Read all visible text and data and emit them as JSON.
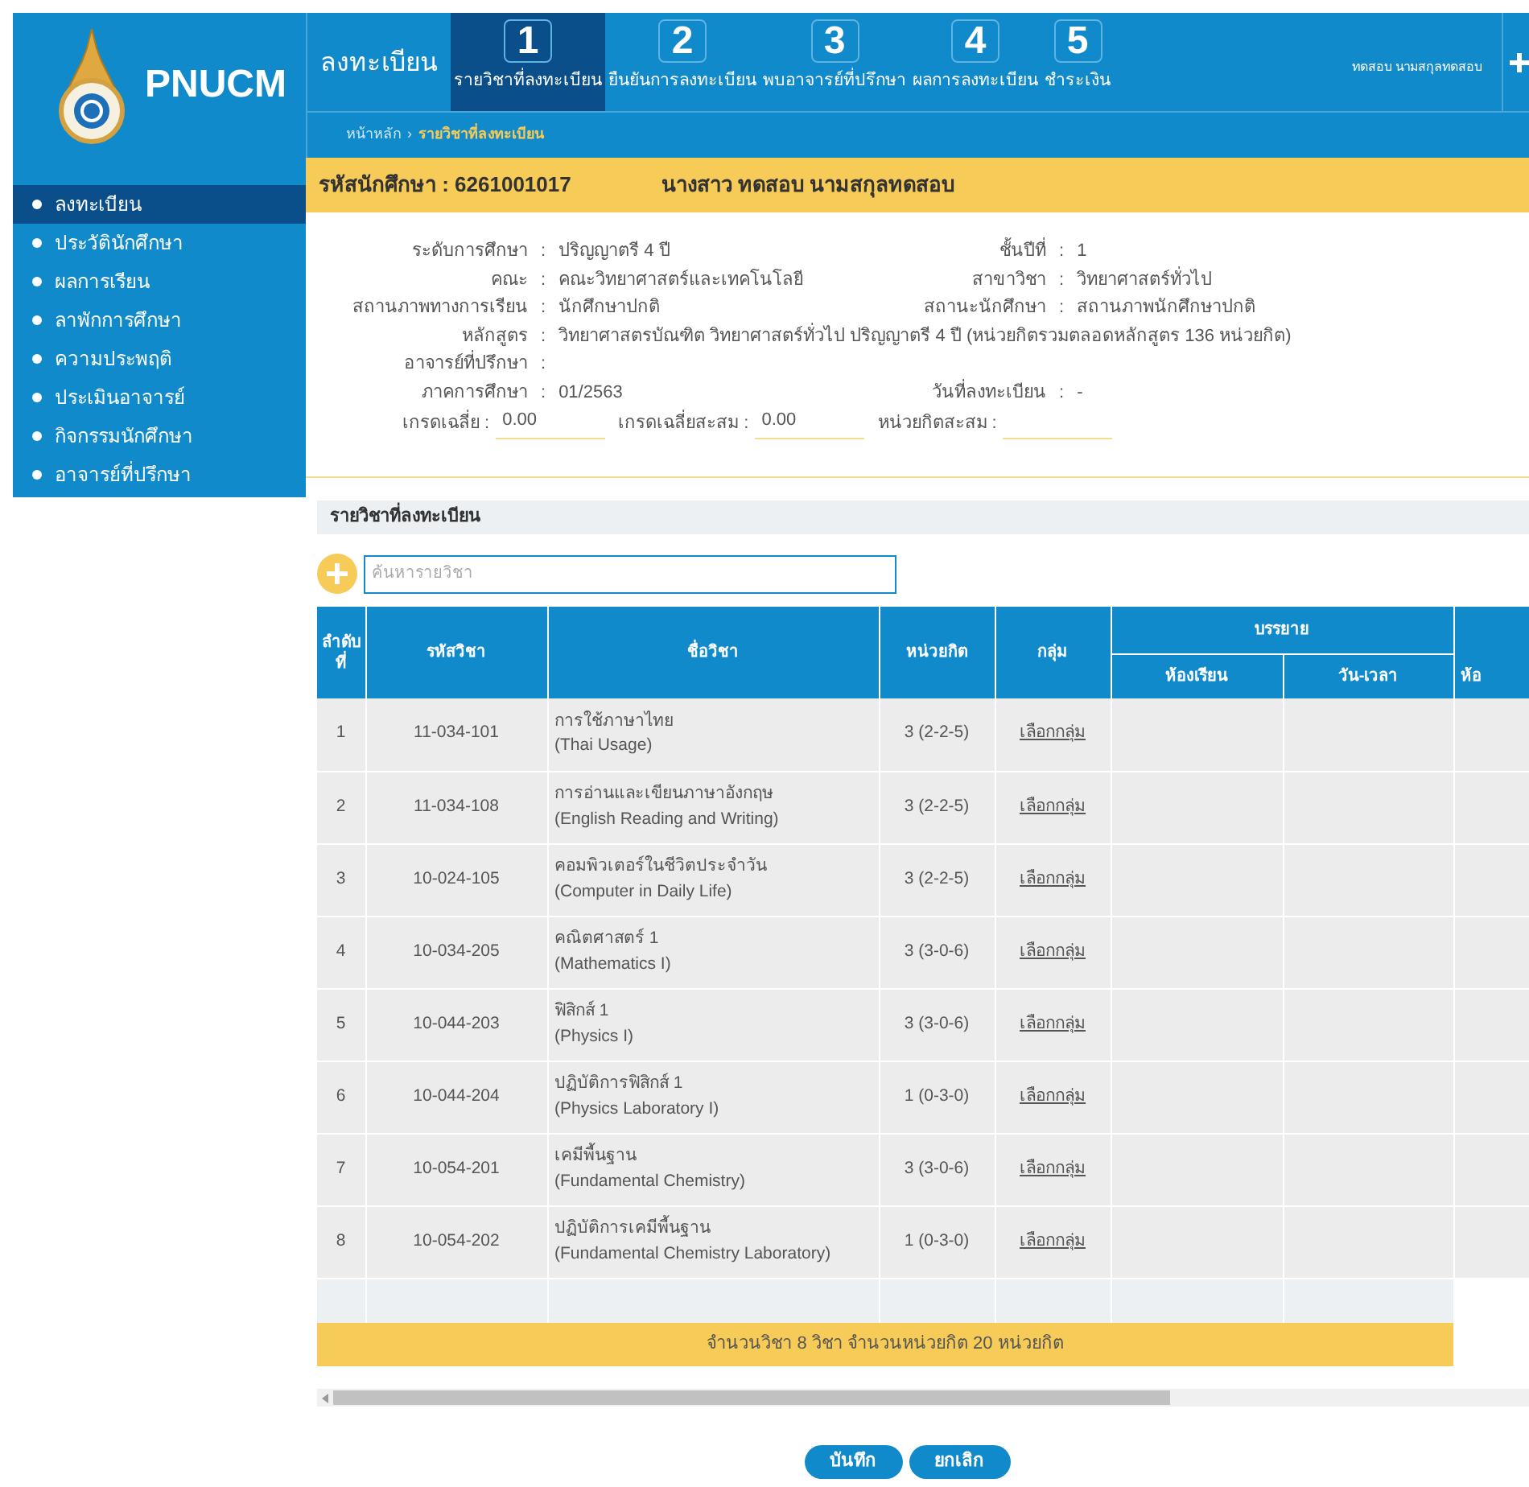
{
  "header": {
    "logo_text": "PNUCM",
    "title": "ลงทะเบียน",
    "steps": [
      {
        "number": "1",
        "label": "รายวิชาที่ลงทะเบียน",
        "selected": true
      },
      {
        "number": "2",
        "label": "ยืนยันการลงทะเบียน",
        "selected": false
      },
      {
        "number": "3",
        "label": "พบอาจารย์ที่ปรึกษา",
        "selected": false
      },
      {
        "number": "4",
        "label": "ผลการลงทะเบียน",
        "selected": false
      },
      {
        "number": "5",
        "label": "ชำระเงิน",
        "selected": false
      }
    ],
    "user_name": "ทดสอบ นามสกุลทดสอบ",
    "breadcrumb": {
      "home": "หน้าหลัก",
      "separator": "›",
      "current": "รายวิชาที่ลงทะเบียน"
    }
  },
  "sidebar": {
    "items": [
      {
        "label": "ลงทะเบียน",
        "selected": true
      },
      {
        "label": "ประวัตินักศึกษา",
        "selected": false
      },
      {
        "label": "ผลการเรียน",
        "selected": false
      },
      {
        "label": "ลาพักการศึกษา",
        "selected": false
      },
      {
        "label": "ความประพฤติ",
        "selected": false
      },
      {
        "label": "ประเมินอาจารย์",
        "selected": false
      },
      {
        "label": "กิจกรรมนักศึกษา",
        "selected": false
      },
      {
        "label": "อาจารย์ที่ปรึกษา",
        "selected": false
      }
    ]
  },
  "student_bar": {
    "id_text": "รหัสนักศึกษา : 6261001017",
    "name": "นางสาว ทดสอบ นามสกุลทดสอบ"
  },
  "info": {
    "separator": ":",
    "rows": [
      {
        "left": {
          "label": "ระดับการศึกษา",
          "value": "ปริญญาตรี 4 ปี"
        },
        "right": {
          "label": "ชั้นปีที่",
          "value": "1"
        }
      },
      {
        "left": {
          "label": "คณะ",
          "value": "คณะวิทยาศาสตร์และเทคโนโลยี"
        },
        "right": {
          "label": "สาขาวิชา",
          "value": "วิทยาศาสตร์ทั่วไป"
        }
      },
      {
        "left": {
          "label": "สถานภาพทางการเรียน",
          "value": "นักศึกษาปกติ"
        },
        "right": {
          "label": "สถานะนักศึกษา",
          "value": "สถานภาพนักศึกษาปกติ"
        }
      },
      {
        "left": {
          "label": "หลักสูตร",
          "value": "วิทยาศาสตรบัณฑิต วิทยาศาสตร์ทั่วไป ปริญญาตรี 4 ปี (หน่วยกิตรวมตลอดหลักสูตร 136 หน่วยกิต)"
        }
      },
      {
        "left": {
          "label": "อาจารย์ที่ปรึกษา"
        }
      },
      {
        "left": {
          "label": "ภาคการศึกษา",
          "value": "01/2563"
        },
        "right": {
          "label": "วันที่ลงทะเบียน",
          "value": "-"
        }
      }
    ],
    "grades": [
      {
        "label": "เกรดเฉลี่ย :",
        "value": "0.00"
      },
      {
        "label": "เกรดเฉลี่ยสะสม :",
        "value": "0.00"
      },
      {
        "label": "หน่วยกิตสะสม :"
      }
    ]
  },
  "section_title": "รายวิชาที่ลงทะเบียน",
  "search": {
    "placeholder": "ค้นหารายวิชา"
  },
  "table": {
    "columns": [
      "ลำดับที่",
      "รหัสวิชา",
      "ชื่อวิชา",
      "หน่วยกิต",
      "กลุ่ม"
    ],
    "group_header": "บรรยาย",
    "sub_columns": [
      "ห้องเรียน",
      "วัน-เวลา"
    ],
    "cut_column": "ห้อ",
    "rows": [
      {
        "no": "1",
        "code": "11-034-101",
        "name_th": "การใช้ภาษาไทย",
        "name_en": "(Thai Usage)",
        "credits": "3 (2-2-5)",
        "group": "เลือกกลุ่ม"
      },
      {
        "no": "2",
        "code": "11-034-108",
        "name_th": "การอ่านและเขียนภาษาอังกฤษ",
        "name_en": "(English Reading and Writing)",
        "credits": "3 (2-2-5)",
        "group": "เลือกกลุ่ม"
      },
      {
        "no": "3",
        "code": "10-024-105",
        "name_th": "คอมพิวเตอร์ในชีวิตประจำวัน",
        "name_en": "(Computer in Daily Life)",
        "credits": "3 (2-2-5)",
        "group": "เลือกกลุ่ม"
      },
      {
        "no": "4",
        "code": "10-034-205",
        "name_th": "คณิตศาสตร์ 1",
        "name_en": "(Mathematics I)",
        "credits": "3 (3-0-6)",
        "group": "เลือกกลุ่ม"
      },
      {
        "no": "5",
        "code": "10-044-203",
        "name_th": "ฟิสิกส์ 1",
        "name_en": "(Physics I)",
        "credits": "3 (3-0-6)",
        "group": "เลือกกลุ่ม"
      },
      {
        "no": "6",
        "code": "10-044-204",
        "name_th": "ปฏิบัติการฟิสิกส์ 1",
        "name_en": "(Physics Laboratory I)",
        "credits": "1 (0-3-0)",
        "group": "เลือกกลุ่ม"
      },
      {
        "no": "7",
        "code": "10-054-201",
        "name_th": "เคมีพื้นฐาน",
        "name_en": "(Fundamental Chemistry)",
        "credits": "3 (3-0-6)",
        "group": "เลือกกลุ่ม"
      },
      {
        "no": "8",
        "code": "10-054-202",
        "name_th": "ปฏิบัติการเคมีพื้นฐาน",
        "name_en": "(Fundamental Chemistry Laboratory)",
        "credits": "1 (0-3-0)",
        "group": "เลือกกลุ่ม"
      }
    ],
    "summary": "จำนวนวิชา 8 วิชา จำนวนหน่วยกิต 20 หน่วยกิต"
  },
  "buttons": [
    "บันทึก",
    "ยกเลิก"
  ]
}
